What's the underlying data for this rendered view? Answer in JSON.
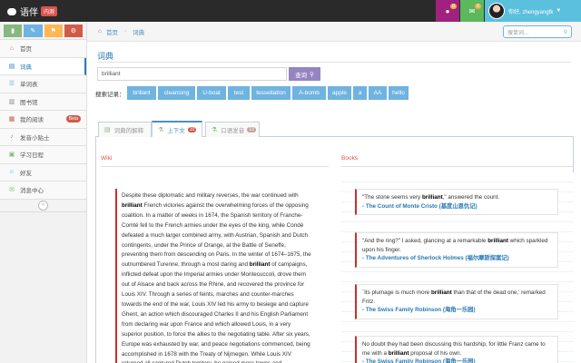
{
  "navbar": {
    "brand": "语伴",
    "brand_badge": "内测",
    "bell_count": "0",
    "mail_count": "0",
    "user_greeting": "你好, zhengyangfk"
  },
  "sidebar": {
    "items": [
      {
        "label": "首页",
        "icon": "home-icon"
      },
      {
        "label": "词典",
        "icon": "book-icon",
        "active": true
      },
      {
        "label": "单词表",
        "icon": "list-icon"
      },
      {
        "label": "图书馆",
        "icon": "library-icon"
      },
      {
        "label": "我的阅读",
        "icon": "reading-icon",
        "badge": "Beta"
      },
      {
        "label": "发音小贴士",
        "icon": "microphone-icon"
      },
      {
        "label": "学习日程",
        "icon": "calendar-icon"
      },
      {
        "label": "好友",
        "icon": "friends-icon"
      },
      {
        "label": "消息中心",
        "icon": "message-icon"
      }
    ]
  },
  "breadcrumb": {
    "home": "首页",
    "current": "词典"
  },
  "search": {
    "placeholder": "搜单词..."
  },
  "main": {
    "title": "词典",
    "word": "brilliant",
    "query_button": "查询",
    "history_label": "搜索记录：",
    "history": [
      "brillant",
      "cleansing",
      "U-boat",
      "test",
      "tessellation",
      "A-bomb",
      "apple",
      "a",
      "AA",
      "hello"
    ]
  },
  "tabs": [
    {
      "label": "词典的解释",
      "count": ""
    },
    {
      "label": "上下文",
      "count": "10"
    },
    {
      "label": "口语发音",
      "count": "10"
    }
  ],
  "wiki": {
    "heading": "Wiki",
    "parts": [
      {
        "t": "Despite these diplomatic and military reverses, the war continued with "
      },
      {
        "b": "brilliant"
      },
      {
        "t": " French victories against the overwhelming forces of the opposing coalition. In a matter of weeks in 1674, the Spanish territory of Franche-Comté fell to the French armies under the eyes of the king, while Condé defeated a much larger combined army, with Austrian, Spanish and Dutch contingents, under the Prince of Orange, at the Battle of Seneffe, preventing them from descending on Paris. In the winter of 1674–1675, the outnumbered Turenne, through a most daring and "
      },
      {
        "b": "brilliant"
      },
      {
        "t": " of campaigns, inflicted defeat upon the Imperial armies under Montecuccoli, drove them out of Alsace and back across the Rhine, and recovered the province for Louis XIV. Through a series of feints, marches and counter-marches towards the end of the war, Louis XIV led his army to besiege and capture Ghent, an action which discouraged Charles II and his English Parliament from declaring war upon France and which allowed Louis, in a very superior position, to force the allies to the negotiating table. After six years, Europe was exhausted by war, and peace negotiations commenced, being accomplished in 1678 with the Treaty of Nijmegen. While Louis XIV returned all captured Dutch territory, he gained more towns and"
      }
    ]
  },
  "books": {
    "heading": "Books",
    "quotes": [
      {
        "pre": "\"The stone seems very ",
        "word": "brilliant",
        "post": ",\" answered the count.",
        "source": "- The Count of Monte Cristo (基度山恩仇记)"
      },
      {
        "pre": "\"And the ring?\" I asked, glancing at a remarkable ",
        "word": "brilliant",
        "post": " which sparkled upon his finger.",
        "source": "- The Adventures of Sherlock Holmes (福尔摩斯探案记)"
      },
      {
        "pre": "`Its plumage is much more ",
        "word": "brilliant",
        "post": " than that of the dead one,' remarked Fritz.",
        "source": "- The Swiss Family Robinson (海角一乐园)"
      },
      {
        "pre": "No doubt they had been discussing this hardship, for little Franz came to me with a ",
        "word": "brilliant",
        "post": " proposal of his own.",
        "source": "- The Swiss Family Robinson (海角一乐园)"
      }
    ]
  }
}
